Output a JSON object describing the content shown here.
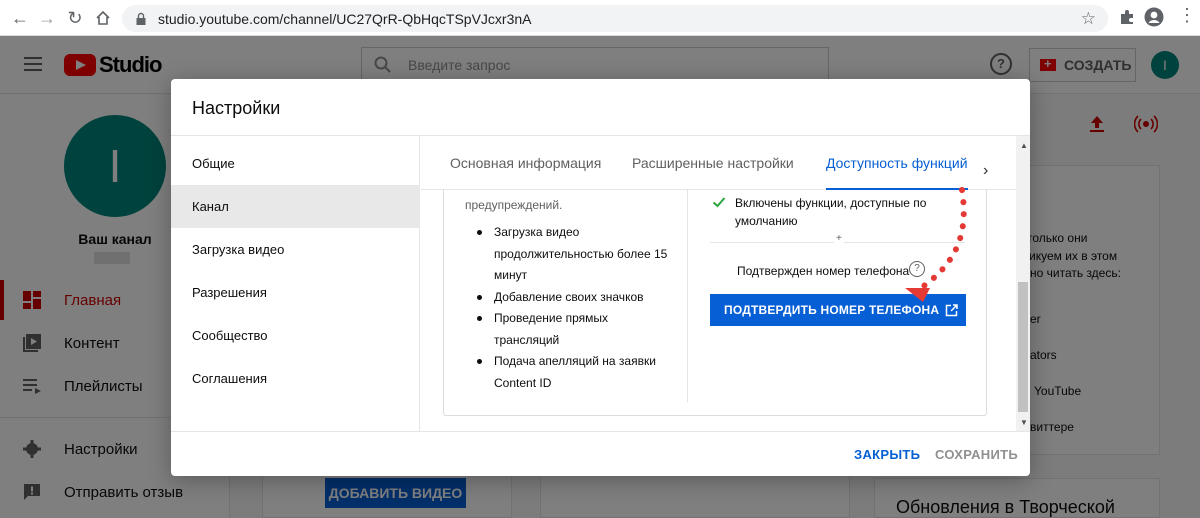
{
  "browser": {
    "url": "studio.youtube.com/channel/UC27QrR-QbHqcTSpVJcxr3nA"
  },
  "header": {
    "logo_text": "Studio",
    "search_placeholder": "Введите запрос",
    "help_label": "?",
    "create_label": "СОЗДАТЬ",
    "avatar_letter": "I"
  },
  "sidebar": {
    "avatar_letter": "I",
    "channel_label": "Ваш канал",
    "items": [
      {
        "label": "Главная",
        "icon": "dashboard-icon",
        "active": true
      },
      {
        "label": "Контент",
        "icon": "content-icon"
      },
      {
        "label": "Плейлисты",
        "icon": "playlist-icon"
      },
      {
        "label": "Настройки",
        "icon": "gear-icon"
      },
      {
        "label": "Отправить отзыв",
        "icon": "feedback-icon"
      }
    ]
  },
  "background": {
    "add_video_label": "ДОБАВИТЬ ВИДЕО",
    "side_lines": [
      "только они",
      "ликуем их в этом",
      "но читать здесь:",
      "er",
      "ators",
      "YouTube",
      "виттере"
    ],
    "updates_title": "Обновления в Творческой"
  },
  "dialog": {
    "title": "Настройки",
    "nav": [
      "Общие",
      "Канал",
      "Загрузка видео",
      "Разрешения",
      "Сообщество",
      "Соглашения"
    ],
    "active_nav": "Канал",
    "tabs": [
      "Основная информация",
      "Расширенные настройки",
      "Доступность функций"
    ],
    "active_tab": "Доступность функций",
    "warnings_tail": "предупреждений.",
    "features": [
      "Загрузка видео продолжительностью более 15 минут",
      "Добавление своих значков",
      "Проведение прямых трансляций",
      "Подача апелляций на заявки Content ID"
    ],
    "enabled_text": "Включены функции, доступные по умолчанию",
    "plus": "+",
    "phone_status": "Подтвержден номер телефона",
    "verify_button": "ПОДТВЕРДИТЬ НОМЕР ТЕЛЕФОНА",
    "close_button": "ЗАКРЫТЬ",
    "save_button": "СОХРАНИТЬ"
  },
  "colors": {
    "accent": "#065fd4",
    "brand_red": "#ff0000",
    "avatar_teal": "#00857a",
    "annotation_red": "#e53935"
  }
}
